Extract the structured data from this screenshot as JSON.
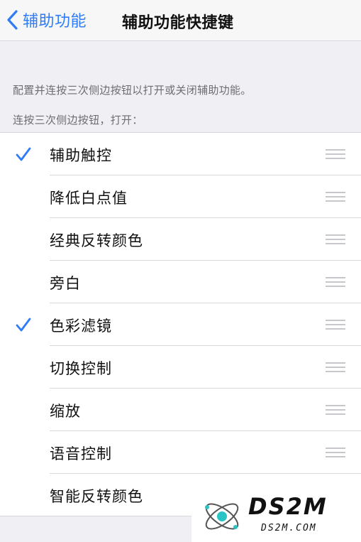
{
  "navbar": {
    "back_label": "辅助功能",
    "title": "辅助功能快捷键"
  },
  "description": "配置并连按三次侧边按钮以打开或关闭辅助功能。",
  "section_header": "连按三次侧边按钮，打开：",
  "items": [
    {
      "label": "辅助触控",
      "checked": true
    },
    {
      "label": "降低白点值",
      "checked": false
    },
    {
      "label": "经典反转颜色",
      "checked": false
    },
    {
      "label": "旁白",
      "checked": false
    },
    {
      "label": "色彩滤镜",
      "checked": true
    },
    {
      "label": "切换控制",
      "checked": false
    },
    {
      "label": "缩放",
      "checked": false
    },
    {
      "label": "语音控制",
      "checked": false
    },
    {
      "label": "智能反转颜色",
      "checked": false
    }
  ],
  "colors": {
    "accent": "#2f7cf6",
    "background": "#efeff4"
  },
  "watermark": {
    "main": "DS2M",
    "sub": "DS2M.COM"
  }
}
